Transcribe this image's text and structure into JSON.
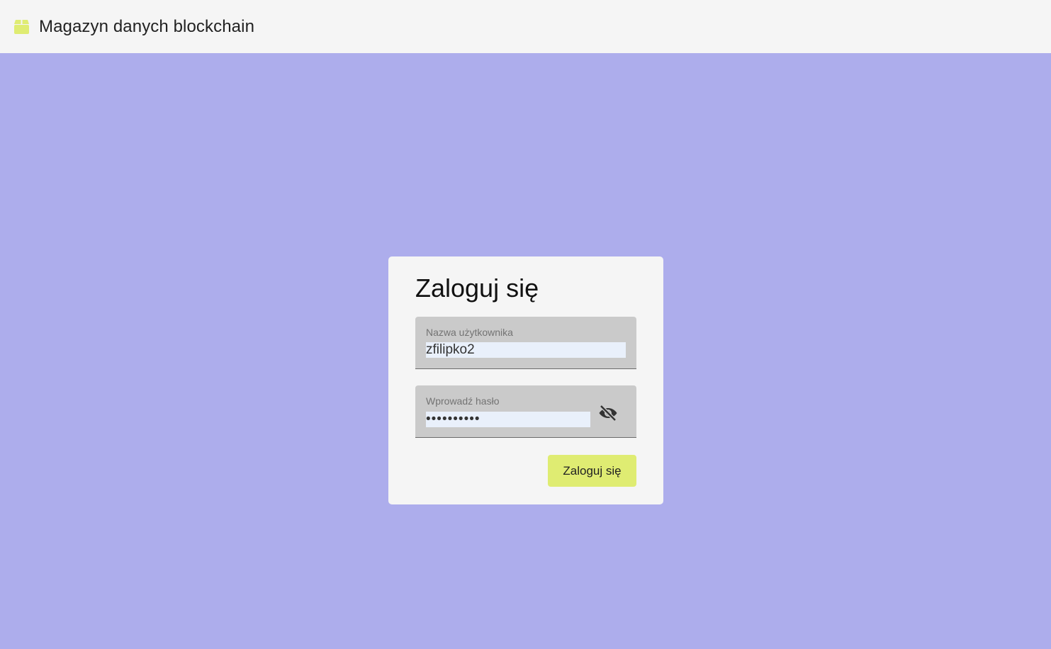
{
  "header": {
    "app_icon": "package-icon",
    "title": "Magazyn danych blockchain"
  },
  "login": {
    "title": "Zaloguj się",
    "username": {
      "label": "Nazwa użytkownika",
      "value": "zfilipko2"
    },
    "password": {
      "label": "Wprowadź hasło",
      "value": "••••••••••",
      "toggle_icon": "eye-off-icon"
    },
    "submit_label": "Zaloguj się"
  },
  "colors": {
    "background": "#adadec",
    "header_bg": "#f5f5f5",
    "card_bg": "#f5f5f5",
    "accent": "#dfec72",
    "field_bg": "#cacaca",
    "input_autofill_bg": "#e9f0fb"
  }
}
